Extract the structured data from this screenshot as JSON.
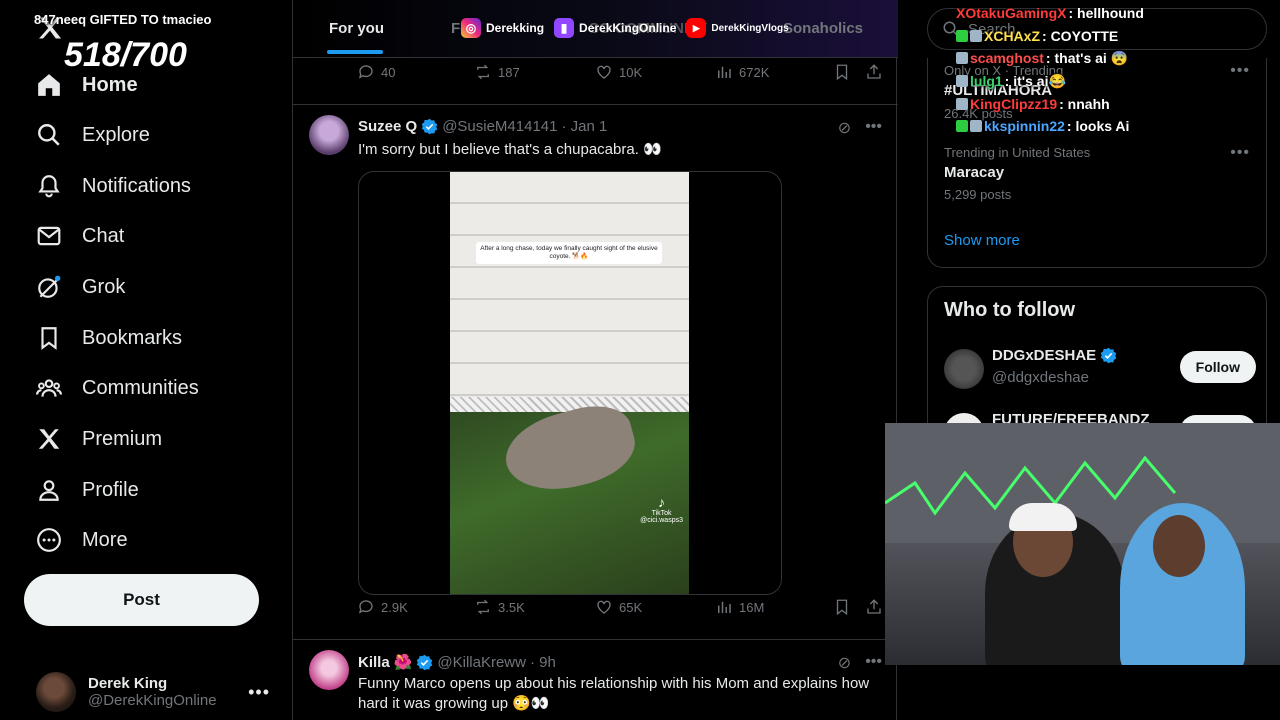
{
  "overlay": {
    "gift_text": "847neeq GIFTED TO tmacieo",
    "counter": "518/700"
  },
  "sidebar": {
    "items": [
      {
        "label": "Home",
        "icon": "home-icon"
      },
      {
        "label": "Explore",
        "icon": "search-icon"
      },
      {
        "label": "Notifications",
        "icon": "bell-icon"
      },
      {
        "label": "Chat",
        "icon": "mail-icon"
      },
      {
        "label": "Grok",
        "icon": "grok-icon"
      },
      {
        "label": "Bookmarks",
        "icon": "bookmark-icon"
      },
      {
        "label": "Communities",
        "icon": "communities-icon"
      },
      {
        "label": "Premium",
        "icon": "x-icon"
      },
      {
        "label": "Profile",
        "icon": "person-icon"
      },
      {
        "label": "More",
        "icon": "more-circle-icon"
      }
    ],
    "post_label": "Post",
    "profile": {
      "name": "Derek King",
      "handle": "@DerekKingOnline",
      "more": "•••"
    }
  },
  "tabs": {
    "for_you": "For you",
    "following_partial": "Fo",
    "partial_2": "SO COMMUNITY",
    "partial_3": "Sonaholics"
  },
  "socials": {
    "instagram": "Derekking",
    "twitch": "DerekKingOnline",
    "youtube": "DerekKingVlogs"
  },
  "top_actions": {
    "replies": "40",
    "reposts": "187",
    "likes": "10K",
    "views": "672K"
  },
  "tweet1": {
    "name": "Suzee Q",
    "handle": "@SusieM414141",
    "date": "· Jan 1",
    "text": "I'm sorry but I believe that's a chupacabra. 👀",
    "video_caption": "After a long chase, today we finally caught sight of the elusive coyote. 🐕🔥",
    "tiktok_label": "TikTok",
    "tiktok_handle": "@cici.wasps3",
    "actions": {
      "replies": "2.9K",
      "reposts": "3.5K",
      "likes": "65K",
      "views": "16M"
    }
  },
  "tweet2": {
    "name": "Killa",
    "emoji": "🌺",
    "handle": "@KillaKreww",
    "date": "· 9h",
    "text": "Funny Marco opens up about his relationship with his Mom and explains how hard it was growing up 😳👀"
  },
  "right": {
    "search_placeholder": "Search",
    "trends": [
      {
        "meta": "Only on X · Trending",
        "name": "#ULTIMAHORA",
        "count": "26.4K posts"
      },
      {
        "meta": "Trending in United States",
        "name": "Maracay",
        "count": "5,299 posts"
      }
    ],
    "show_more": "Show more",
    "who_title": "Who to follow",
    "follow": [
      {
        "name": "DDGxDESHAE",
        "handle": "@ddgxdeshae",
        "button": "Follow"
      },
      {
        "name": "FUTURE/FREEBANDZ",
        "handle": "",
        "button": "Follow"
      }
    ]
  },
  "chat": [
    {
      "user": "XOtakuGamingX",
      "message": ": hellhound",
      "color": "#ff3b3b"
    },
    {
      "user": "XCHAxZ",
      "message": ": COYOTTE",
      "color": "#ffe14d"
    },
    {
      "user": "scamghost",
      "message": ": that's ai 😨",
      "color": "#ff4d4d"
    },
    {
      "user": "lulg1",
      "message": ": it's ai😂",
      "color": "#3bd16f"
    },
    {
      "user": "KingClipzz19",
      "message": ": nnahh",
      "color": "#ff3b3b"
    },
    {
      "user": "kkspinnin22",
      "message": ": looks Ai",
      "color": "#4da6ff"
    }
  ],
  "colors": {
    "accent": "#1d9bf0",
    "bg": "#000000",
    "text": "#e7e9ea",
    "muted": "#71767b"
  }
}
